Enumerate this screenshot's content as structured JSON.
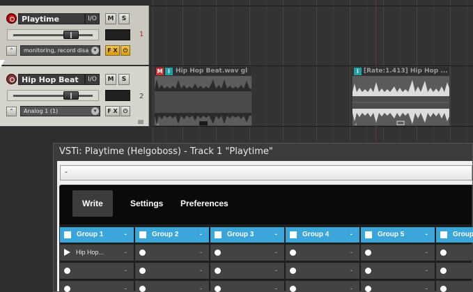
{
  "tracks": [
    {
      "name": "Playtime",
      "io_label": "I/O",
      "mute_label": "M",
      "solo_label": "S",
      "number": "1",
      "mode": "monitoring, record disa",
      "fx_label": "F X",
      "power_label": "⏻"
    },
    {
      "name": "Hip Hop Beat",
      "io_label": "I/O",
      "mute_label": "M",
      "solo_label": "S",
      "number": "2",
      "mode": "Analog 1 (1)",
      "fx_label": "F X",
      "power_label": "⏻"
    }
  ],
  "items": [
    {
      "m_badge": "M",
      "i_badge": "i",
      "title": "Hip Hop Beat.wav gl"
    },
    {
      "i_badge": "i",
      "title": "[Rate:1.413] Hip Hop ..."
    }
  ],
  "vst": {
    "title": "VSTi: Playtime (Helgoboss) - Track 1 \"Playtime\"",
    "preset": "-",
    "menu": [
      "Write",
      "Settings",
      "Preferences"
    ],
    "active_menu": "Write",
    "groups": [
      {
        "name": "Group 1",
        "dash": "-",
        "slots": [
          {
            "label": "Hip Hop...",
            "playing": true,
            "dash": "-"
          },
          {
            "label": "",
            "playing": false,
            "dash": "-"
          },
          {
            "label": "",
            "playing": false,
            "dash": "-"
          }
        ]
      },
      {
        "name": "Group 2",
        "dash": "-",
        "slots": [
          {
            "label": "",
            "playing": false,
            "dash": "-"
          },
          {
            "label": "",
            "playing": false,
            "dash": "-"
          },
          {
            "label": "",
            "playing": false,
            "dash": "-"
          }
        ]
      },
      {
        "name": "Group 3",
        "dash": "-",
        "slots": [
          {
            "label": "",
            "playing": false,
            "dash": "-"
          },
          {
            "label": "",
            "playing": false,
            "dash": "-"
          },
          {
            "label": "",
            "playing": false,
            "dash": "-"
          }
        ]
      },
      {
        "name": "Group 4",
        "dash": "-",
        "slots": [
          {
            "label": "",
            "playing": false,
            "dash": "-"
          },
          {
            "label": "",
            "playing": false,
            "dash": "-"
          },
          {
            "label": "",
            "playing": false,
            "dash": "-"
          }
        ]
      },
      {
        "name": "Group 5",
        "dash": "-",
        "slots": [
          {
            "label": "",
            "playing": false,
            "dash": "-"
          },
          {
            "label": "",
            "playing": false,
            "dash": "-"
          },
          {
            "label": "",
            "playing": false,
            "dash": "-"
          }
        ]
      },
      {
        "name": "Group",
        "dash": "",
        "slots": [
          {
            "label": "",
            "playing": false,
            "dash": ""
          },
          {
            "label": "",
            "playing": false,
            "dash": ""
          },
          {
            "label": "",
            "playing": false,
            "dash": ""
          }
        ]
      }
    ]
  }
}
